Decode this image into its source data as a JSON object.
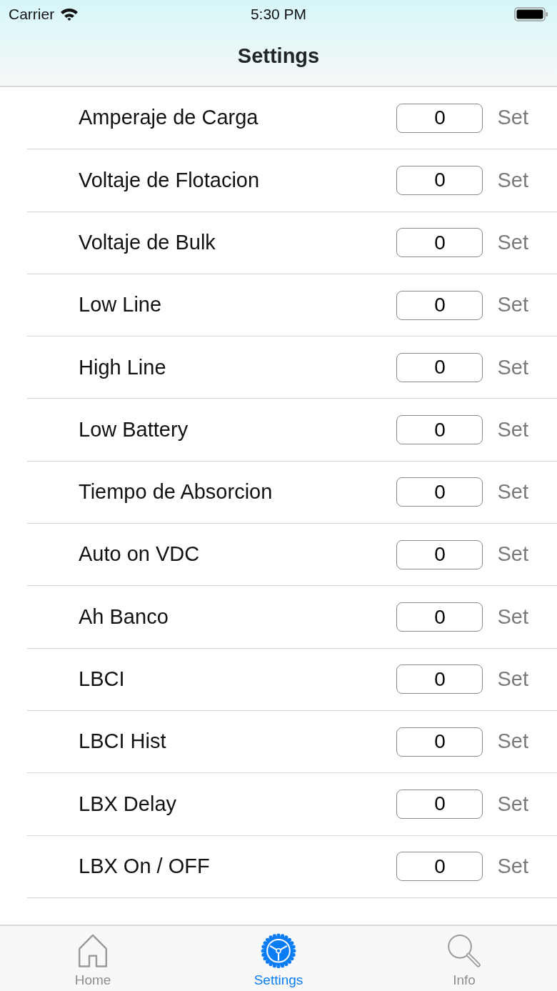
{
  "status_bar": {
    "carrier": "Carrier",
    "time": "5:30 PM"
  },
  "nav_title": "Settings",
  "rows": [
    {
      "label": "Amperaje de Carga",
      "value": "0",
      "button": "Set"
    },
    {
      "label": "Voltaje de Flotacion",
      "value": "0",
      "button": "Set"
    },
    {
      "label": "Voltaje de Bulk",
      "value": "0",
      "button": "Set"
    },
    {
      "label": "Low Line",
      "value": "0",
      "button": "Set"
    },
    {
      "label": "High Line",
      "value": "0",
      "button": "Set"
    },
    {
      "label": "Low Battery",
      "value": "0",
      "button": "Set"
    },
    {
      "label": "Tiempo de Absorcion",
      "value": "0",
      "button": "Set"
    },
    {
      "label": "Auto on VDC",
      "value": "0",
      "button": "Set"
    },
    {
      "label": "Ah Banco",
      "value": "0",
      "button": "Set"
    },
    {
      "label": "LBCI",
      "value": "0",
      "button": "Set"
    },
    {
      "label": "LBCI Hist",
      "value": "0",
      "button": "Set"
    },
    {
      "label": "LBX Delay",
      "value": "0",
      "button": "Set"
    },
    {
      "label": "LBX On / OFF",
      "value": "0",
      "button": "Set"
    }
  ],
  "tabs": [
    {
      "kind": "home",
      "label": "Home",
      "selected": false
    },
    {
      "kind": "settings",
      "label": "Settings",
      "selected": true
    },
    {
      "kind": "info",
      "label": "Info",
      "selected": false
    }
  ]
}
